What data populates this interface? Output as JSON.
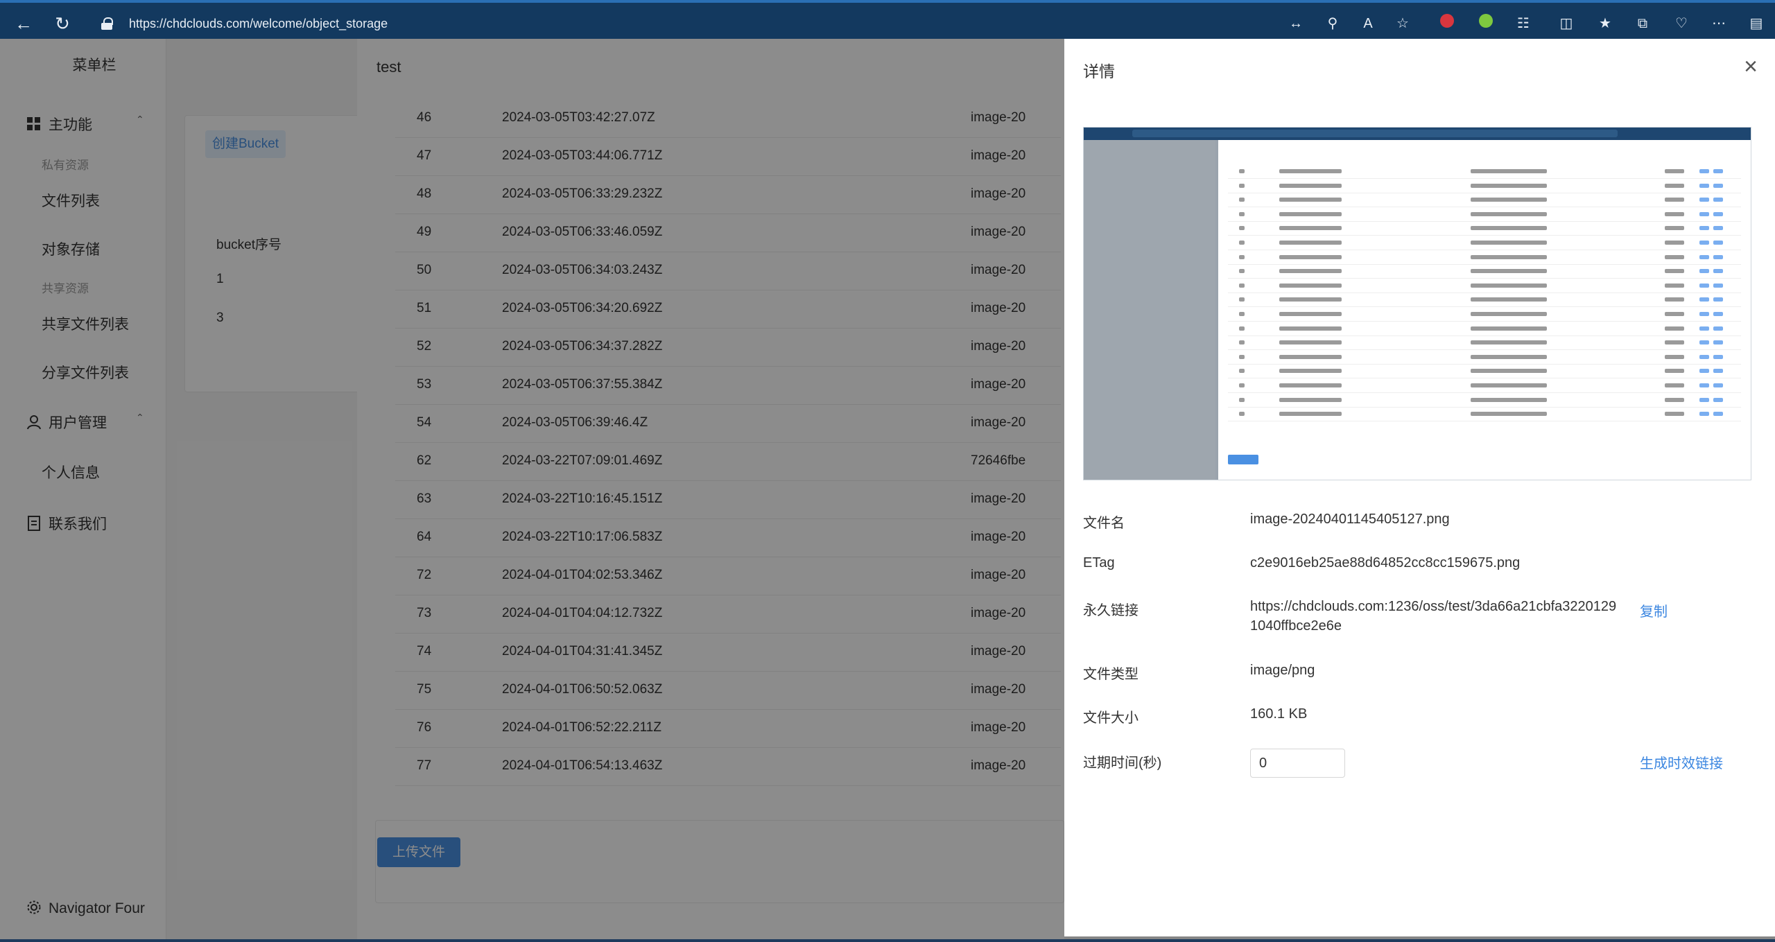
{
  "browser": {
    "url": "https://chdclouds.com/welcome/object_storage"
  },
  "sidebar": {
    "title": "菜单栏",
    "group_main": "主功能",
    "sub_private": "私有资源",
    "item_files": "文件列表",
    "item_objects": "对象存储",
    "sub_shared": "共享资源",
    "item_shared_files": "共享文件列表",
    "item_share_files": "分享文件列表",
    "group_users": "用户管理",
    "item_profile": "个人信息",
    "item_contact": "联系我们",
    "footer": "Navigator Four"
  },
  "main": {
    "create_bucket": "创建Bucket",
    "col_bucket_no": "bucket序号",
    "bucket_rows": [
      "1",
      "3"
    ]
  },
  "dialog": {
    "title": "test",
    "rows": [
      {
        "id": "46",
        "time": "2024-03-05T03:42:27.07Z",
        "name": "image-20"
      },
      {
        "id": "47",
        "time": "2024-03-05T03:44:06.771Z",
        "name": "image-20"
      },
      {
        "id": "48",
        "time": "2024-03-05T06:33:29.232Z",
        "name": "image-20"
      },
      {
        "id": "49",
        "time": "2024-03-05T06:33:46.059Z",
        "name": "image-20"
      },
      {
        "id": "50",
        "time": "2024-03-05T06:34:03.243Z",
        "name": "image-20"
      },
      {
        "id": "51",
        "time": "2024-03-05T06:34:20.692Z",
        "name": "image-20"
      },
      {
        "id": "52",
        "time": "2024-03-05T06:34:37.282Z",
        "name": "image-20"
      },
      {
        "id": "53",
        "time": "2024-03-05T06:37:55.384Z",
        "name": "image-20"
      },
      {
        "id": "54",
        "time": "2024-03-05T06:39:46.4Z",
        "name": "image-20"
      },
      {
        "id": "62",
        "time": "2024-03-22T07:09:01.469Z",
        "name": "72646fbe"
      },
      {
        "id": "63",
        "time": "2024-03-22T10:16:45.151Z",
        "name": "image-20"
      },
      {
        "id": "64",
        "time": "2024-03-22T10:17:06.583Z",
        "name": "image-20"
      },
      {
        "id": "72",
        "time": "2024-04-01T04:02:53.346Z",
        "name": "image-20"
      },
      {
        "id": "73",
        "time": "2024-04-01T04:04:12.732Z",
        "name": "image-20"
      },
      {
        "id": "74",
        "time": "2024-04-01T04:31:41.345Z",
        "name": "image-20"
      },
      {
        "id": "75",
        "time": "2024-04-01T06:50:52.063Z",
        "name": "image-20"
      },
      {
        "id": "76",
        "time": "2024-04-01T06:52:22.211Z",
        "name": "image-20"
      },
      {
        "id": "77",
        "time": "2024-04-01T06:54:13.463Z",
        "name": "image-20"
      }
    ],
    "upload_button": "上传文件"
  },
  "drawer": {
    "title": "详情",
    "filename_label": "文件名",
    "filename": "image-20240401145405127.png",
    "etag_label": "ETag",
    "etag": "c2e9016eb25ae88d64852cc8cc159675.png",
    "permalink_label": "永久链接",
    "permalink_line1": "https://chdclouds.com:1236/oss/test/3da66a21cbfa3220129",
    "permalink_line2": "1040ffbce2e6e",
    "copy_label": "复制",
    "filetype_label": "文件类型",
    "filetype": "image/png",
    "filesize_label": "文件大小",
    "filesize": "160.1 KB",
    "expire_label": "过期时间(秒)",
    "expire_value": "0",
    "generate_link": "生成时效链接"
  }
}
